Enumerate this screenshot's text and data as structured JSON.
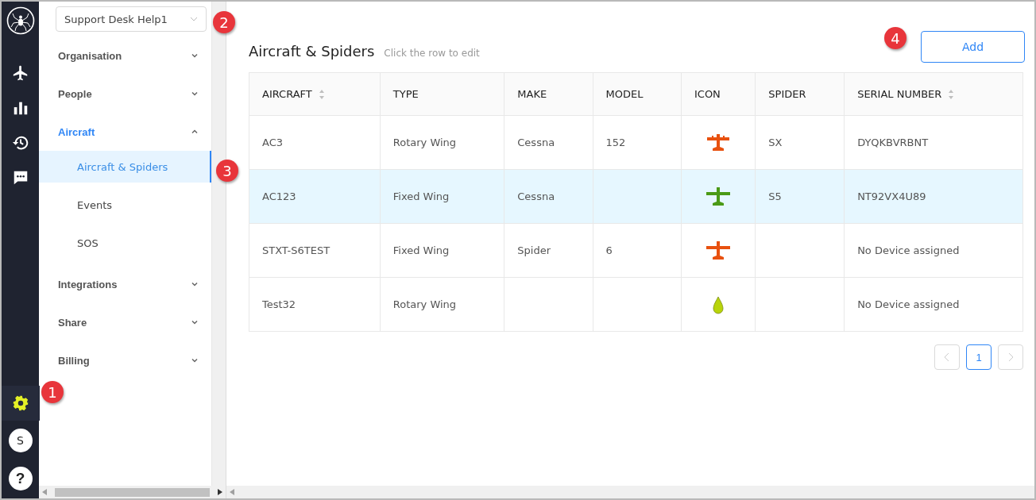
{
  "rail": {
    "items": [
      {
        "kind": "plane"
      },
      {
        "kind": "chart"
      },
      {
        "kind": "history"
      },
      {
        "kind": "chat"
      }
    ],
    "settings": {
      "selected": true
    },
    "avatar": "S",
    "help": "?"
  },
  "org_select": {
    "value": "Support Desk Help1"
  },
  "nav": [
    {
      "label": "Organisation",
      "expanded": false,
      "selected": false
    },
    {
      "label": "People",
      "expanded": false,
      "selected": false
    },
    {
      "label": "Aircraft",
      "expanded": true,
      "selected": true,
      "children": [
        {
          "label": "Aircraft & Spiders",
          "selected": true
        },
        {
          "label": "Events",
          "selected": false
        },
        {
          "label": "SOS",
          "selected": false
        }
      ]
    },
    {
      "label": "Integrations",
      "expanded": false,
      "selected": false
    },
    {
      "label": "Share",
      "expanded": false,
      "selected": false
    },
    {
      "label": "Billing",
      "expanded": false,
      "selected": false
    }
  ],
  "page": {
    "title": "Aircraft & Spiders",
    "hint": "Click the row to edit",
    "add_button": "Add"
  },
  "table": {
    "columns": [
      {
        "label": "AIRCRAFT",
        "sortable": true
      },
      {
        "label": "TYPE",
        "sortable": false
      },
      {
        "label": "MAKE",
        "sortable": false
      },
      {
        "label": "MODEL",
        "sortable": false
      },
      {
        "label": "ICON",
        "sortable": false
      },
      {
        "label": "SPIDER",
        "sortable": false
      },
      {
        "label": "SERIAL NUMBER",
        "sortable": true
      }
    ],
    "rows": [
      {
        "selected": false,
        "cells": [
          "AC3",
          "Rotary Wing",
          "Cessna",
          "152",
          null,
          "SX",
          "DYQKBVRBNT"
        ],
        "icon": {
          "kind": "biplane",
          "color": "#e8510f"
        }
      },
      {
        "selected": true,
        "cells": [
          "AC123",
          "Fixed Wing",
          "Cessna",
          "",
          null,
          "S5",
          "NT92VX4U89"
        ],
        "icon": {
          "kind": "plane",
          "color": "#4a9a16"
        }
      },
      {
        "selected": false,
        "cells": [
          "STXT-S6TEST",
          "Fixed Wing",
          "Spider",
          "6",
          null,
          "",
          "No Device assigned"
        ],
        "icon": {
          "kind": "plane",
          "color": "#e8510f"
        }
      },
      {
        "selected": false,
        "cells": [
          "Test32",
          "Rotary Wing",
          "",
          "",
          null,
          "",
          "No Device assigned"
        ],
        "icon": {
          "kind": "drop",
          "color": "#b8d40a"
        }
      }
    ]
  },
  "pagination": {
    "pages": [
      {
        "label": "1",
        "selected": true
      }
    ]
  },
  "callouts": [
    {
      "label": "1"
    },
    {
      "label": "2"
    },
    {
      "label": "3"
    },
    {
      "label": "4"
    }
  ]
}
